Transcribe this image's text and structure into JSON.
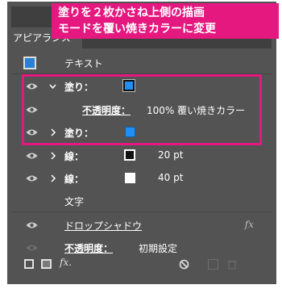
{
  "callout": {
    "line1": "塗りを２枚かさね上側の描画",
    "line2": "モードを覆い焼きカラーに変更"
  },
  "panel": {
    "tab_label": "アピアランス",
    "object_type": "テキスト",
    "rows": {
      "fill1_label": "塗り：",
      "opacity_label": "不透明度：",
      "opacity_value": "100% 覆い焼きカラー",
      "fill2_label": "塗り：",
      "stroke1_label": "線：",
      "stroke1_value": "20 pt",
      "stroke2_label": "線：",
      "stroke2_value": "40 pt",
      "characters_label": "文字",
      "drop_shadow_label": "ドロップシャドウ",
      "effect_fx": "fx",
      "opacity2_label": "不透明度：",
      "opacity2_value": "初期設定"
    },
    "bottom": {
      "fx_label": "fx."
    }
  },
  "colors": {
    "panel_bg": "#535353",
    "accent_pink": "#e4187f",
    "fill_blue": "#1f8ff5"
  }
}
